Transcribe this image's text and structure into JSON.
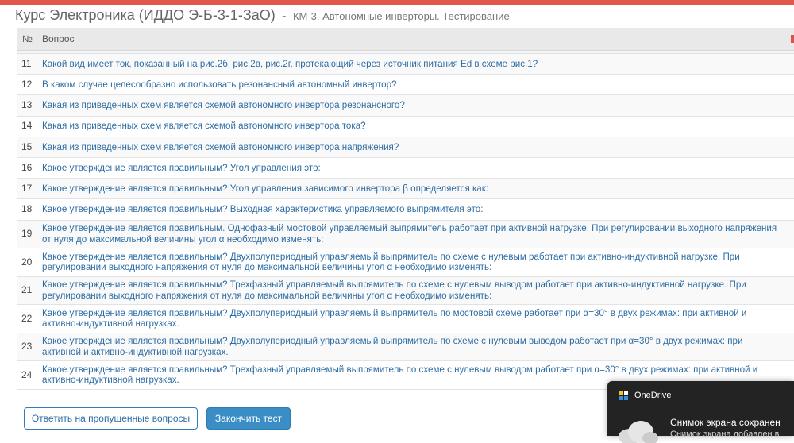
{
  "header": {
    "course": "Курс Электроника (ИДДО Э-Б-3-1-ЗаО)",
    "separator": "-",
    "subtitle": "КМ-3. Автономные инверторы. Тестирование"
  },
  "table": {
    "col_num": "№",
    "col_question": "Вопрос",
    "rows": [
      {
        "num": "11",
        "text": "Какой вид имеет ток, показанный на рис.2б, рис.2в, рис.2г, протекающий через источник питания Ed в схеме рис.1?"
      },
      {
        "num": "12",
        "text": "В каком случае целесообразно использовать резонансный автономный инвертор?"
      },
      {
        "num": "13",
        "text": "Какая из приведенных схем является схемой автономного инвертора резонансного?"
      },
      {
        "num": "14",
        "text": "Какая из приведенных схем является схемой автономного инвертора тока?"
      },
      {
        "num": "15",
        "text": "Какая из приведенных схем является схемой автономного инвертора напряжения?"
      },
      {
        "num": "16",
        "text": "Какое утверждение является правильным? Угол управления это:"
      },
      {
        "num": "17",
        "text": "Какое утверждение является правильным? Угол управления зависимого инвертора β определяется как:"
      },
      {
        "num": "18",
        "text": "Какое утверждение является правильным? Выходная характеристика управляемого выпрямителя это:"
      },
      {
        "num": "19",
        "text": "Какое утверждение является правильным. Однофазный мостовой управляемый выпрямитель работает при активной нагрузке. При регулировании выходного напряжения от нуля до максимальной величины угол α необходимо изменять:"
      },
      {
        "num": "20",
        "text": "Какое утверждение является правильным? Двухполупериодный управляемый выпрямитель по схеме с нулевым работает при активно-индуктивной нагрузке. При регулировании выходного напряжения от нуля до максимальной величины угол α необходимо изменять:"
      },
      {
        "num": "21",
        "text": "Какое утверждение является правильным? Трехфазный управляемый выпрямитель по схеме с нулевым выводом работает при активно-индуктивной нагрузке. При регулировании выходного напряжения от нуля до максимальной величины угол α необходимо изменять:"
      },
      {
        "num": "22",
        "text": "Какое утверждение является правильным? Двухполупериодный управляемый выпрямитель по мостовой схеме работает при α=30° в двух режимах: при активной и активно-индуктивной нагрузках."
      },
      {
        "num": "23",
        "text": "Какое утверждение является правильным? Двухполупериодный управляемый выпрямитель по схеме с нулевым выводом работает при α=30° в двух режимах: при активной и активно-индуктивной нагрузках."
      },
      {
        "num": "24",
        "text": "Какое утверждение является правильным? Трехфазный управляемый выпрямитель по схеме с нулевым выводом работает при α=30° в двух режимах: при активной и активно-индуктивной нагрузках."
      }
    ]
  },
  "buttons": {
    "skip": "Ответить на пропущенные вопросы",
    "finish": "Закончить тест"
  },
  "toast": {
    "app": "OneDrive",
    "title": "Снимок экрана сохранен",
    "body": "Снимок экрана добавлен в",
    "icon": "onedrive-cloud-icon"
  },
  "colors": {
    "accent_stripe": "#e3574a",
    "link": "#2e6da4",
    "button_primary": "#3b8dc6"
  }
}
